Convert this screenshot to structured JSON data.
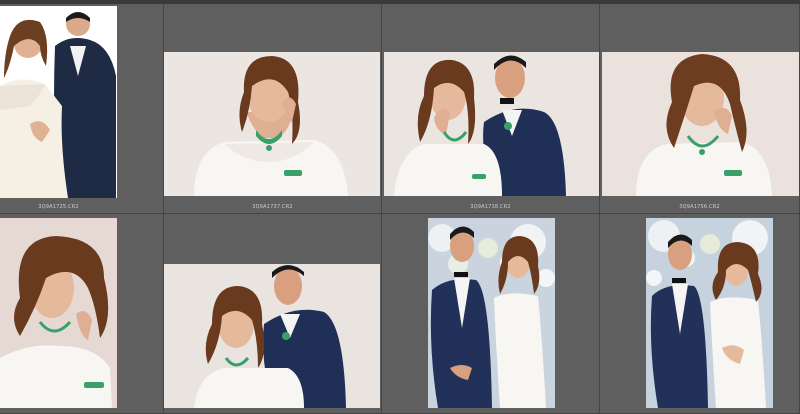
{
  "app": {
    "view": "Grid View"
  },
  "thumbnails": [
    {
      "filename": "3Q9A1725.CR2",
      "subject": "couple-embrace-white-gown"
    },
    {
      "filename": "3Q9A1737.CR2",
      "subject": "woman-offshoulder-white"
    },
    {
      "filename": "3Q9A1738.CR2",
      "subject": "couple-closeup"
    },
    {
      "filename": "3Q9A1756.CR2",
      "subject": "woman-hand-to-lip"
    },
    {
      "filename": "",
      "subject": "woman-portrait-hair"
    },
    {
      "filename": "",
      "subject": "couple-man-behind"
    },
    {
      "filename": "",
      "subject": "couple-standing-floral"
    },
    {
      "filename": "",
      "subject": "couple-standing-floral-2"
    }
  ],
  "colors": {
    "cell_bg": "#5f5f5f",
    "caption_text": "#cfcfcf",
    "suit": "#1f2f55",
    "dress": "#f7f4f0",
    "backdrop": "#ece6e2"
  }
}
